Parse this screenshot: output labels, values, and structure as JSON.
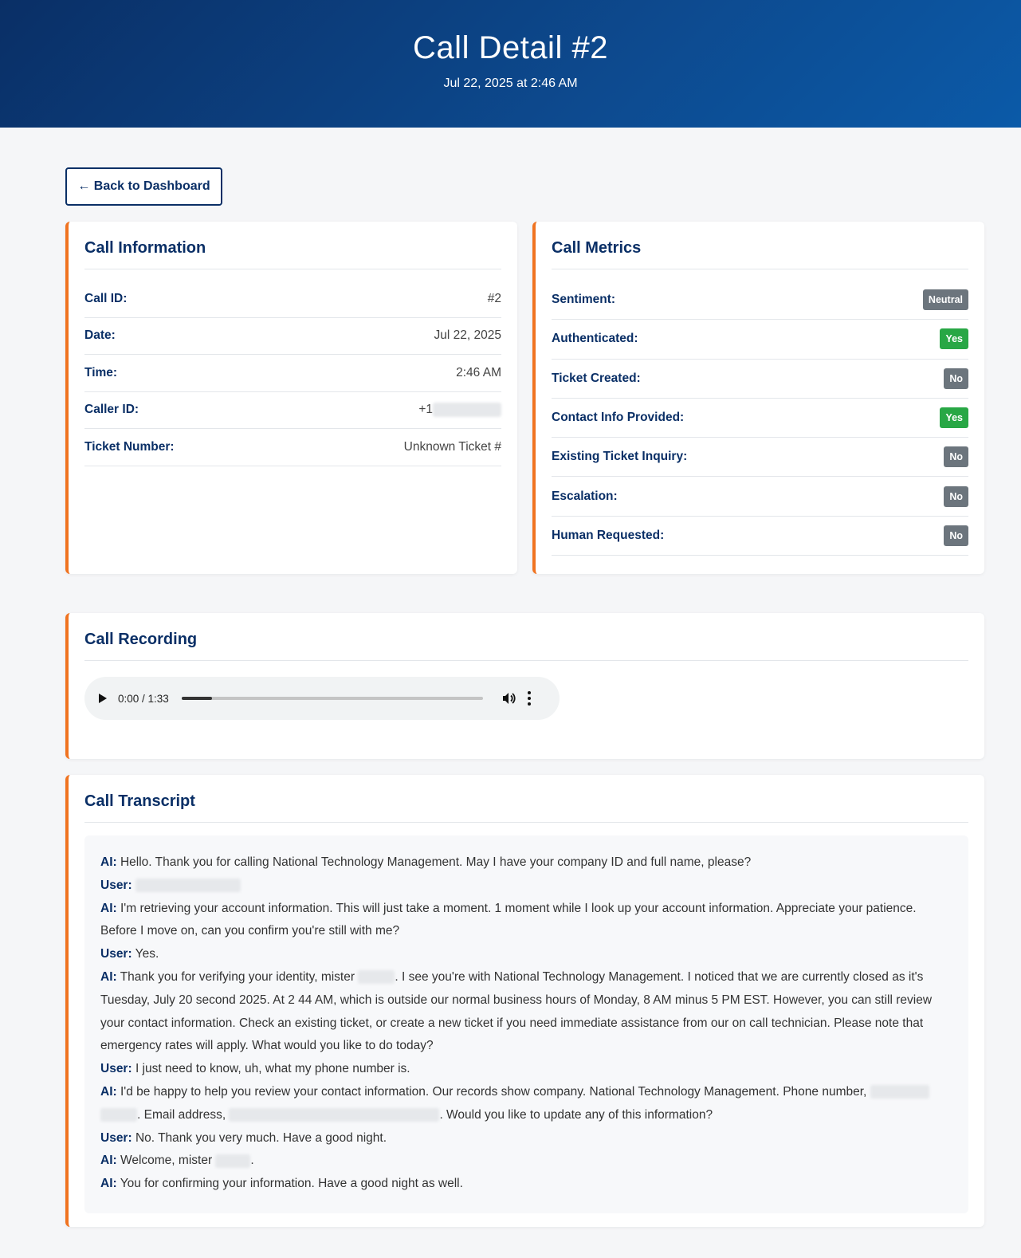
{
  "header": {
    "title": "Call Detail #2",
    "subtitle": "Jul 22, 2025 at 2:46 AM"
  },
  "back_button": "← Back to Dashboard",
  "call_info": {
    "title": "Call Information",
    "rows": [
      {
        "label": "Call ID:",
        "value": "#2"
      },
      {
        "label": "Date:",
        "value": "Jul 22, 2025"
      },
      {
        "label": "Time:",
        "value": "2:46 AM"
      },
      {
        "label": "Caller ID:",
        "value": "+1"
      },
      {
        "label": "Ticket Number:",
        "value": "Unknown Ticket #"
      }
    ]
  },
  "call_metrics": {
    "title": "Call Metrics",
    "rows": [
      {
        "label": "Sentiment:",
        "value": "Neutral",
        "color": "#6c757d"
      },
      {
        "label": "Authenticated:",
        "value": "Yes",
        "color": "#28a745"
      },
      {
        "label": "Ticket Created:",
        "value": "No",
        "color": "#6c757d"
      },
      {
        "label": "Contact Info Provided:",
        "value": "Yes",
        "color": "#28a745"
      },
      {
        "label": "Existing Ticket Inquiry:",
        "value": "No",
        "color": "#6c757d"
      },
      {
        "label": "Escalation:",
        "value": "No",
        "color": "#6c757d"
      },
      {
        "label": "Human Requested:",
        "value": "No",
        "color": "#6c757d"
      }
    ]
  },
  "recording": {
    "title": "Call Recording",
    "time": "0:00 / 1:33",
    "progress": 0.1
  },
  "transcript": {
    "title": "Call Transcript",
    "lines": [
      {
        "speaker": "AI:",
        "text": " Hello. Thank you for calling National Technology Management. May I have your company ID and full name, please?"
      },
      {
        "speaker": "User:",
        "text": " "
      },
      {
        "speaker": "AI:",
        "text": " I'm retrieving your account information. This will just take a moment. 1 moment while I look up your account information. Appreciate your patience. Before I move on, can you confirm you're still with me?"
      },
      {
        "speaker": "User:",
        "text": " Yes."
      },
      {
        "speaker": "AI:",
        "text": " Thank you for verifying your identity, mister "
      },
      {
        "speaker": "User:",
        "text": " I just need to know, uh, what my phone number is."
      },
      {
        "speaker": "AI:",
        "text": " I'd be happy to help you review your contact information. Our records show company. National Technology Management. Phone number, "
      },
      {
        "speaker": "User:",
        "text": " No. Thank you very much. Have a good night."
      },
      {
        "speaker": "AI:",
        "text": " Welcome, mister "
      },
      {
        "speaker": "AI:",
        "text": " You for confirming your information. Have a good night as well."
      }
    ],
    "line5_rest": ". I see you're with National Technology Management. I noticed that we are currently closed as it's Tuesday, July 20 second 2025. At 2 44 AM, which is outside our normal business hours of Monday, 8 AM minus 5 PM EST. However, you can still review your contact information. Check an existing ticket, or create a new ticket if you need immediate assistance from our on call technician. Please note that emergency rates will apply. What would you like to do today?",
    "line7_mid": ". Email address, ",
    "line7_end": ". Would you like to update any of this information?",
    "line9_end": "."
  }
}
